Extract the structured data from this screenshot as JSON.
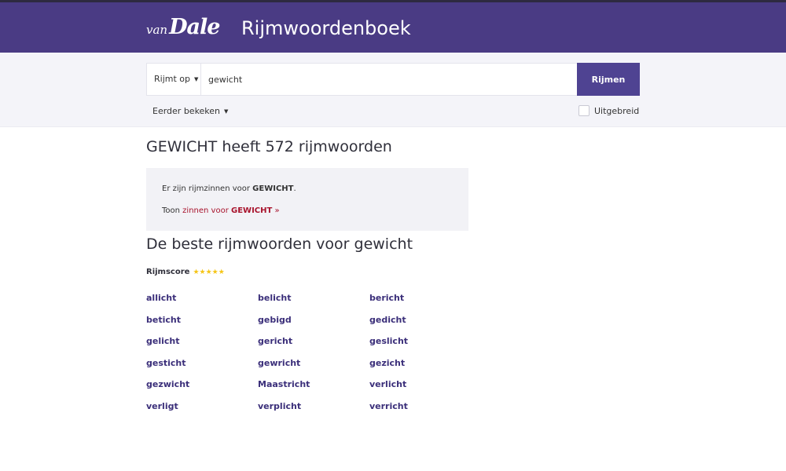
{
  "header": {
    "logo_van": "van",
    "logo_dale": "Dale",
    "title": "Rijmwoordenboek"
  },
  "search": {
    "mode_label": "Rijmt op",
    "query": "gewicht",
    "button_label": "Rijmen",
    "history_label": "Eerder bekeken",
    "advanced_label": "Uitgebreid",
    "advanced_checked": false
  },
  "result": {
    "heading": "GEWICHT heeft 572 rijmwoorden",
    "info_text_prefix": "Er zijn rijmzinnen voor ",
    "info_word": "GEWICHT",
    "info_text_suffix": ".",
    "show_prefix": "Toon ",
    "show_link_prefix": "zinnen voor ",
    "show_link_word": "GEWICHT",
    "show_link_suffix": " »"
  },
  "best": {
    "heading": "De beste rijmwoorden voor gewicht",
    "score_label": "Rijmscore",
    "stars": "★★★★★",
    "star_color": "#f5c518",
    "words": [
      "allicht",
      "belicht",
      "bericht",
      "beticht",
      "gebigd",
      "gedicht",
      "gelicht",
      "gericht",
      "geslicht",
      "gesticht",
      "gewricht",
      "gezicht",
      "gezwicht",
      "Maastricht",
      "verlicht",
      "verligt",
      "verplicht",
      "verricht"
    ]
  },
  "colors": {
    "header_bg": "#4a3b84",
    "button_bg": "#4f4392",
    "link": "#3b2f7a",
    "accent_link": "#a8132c"
  }
}
